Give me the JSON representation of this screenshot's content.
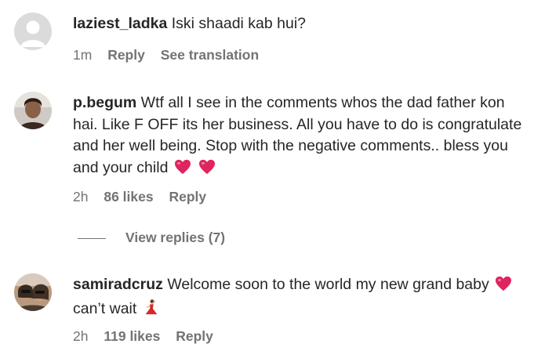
{
  "comments": [
    {
      "username": "laziest_ladka",
      "text": "Iski shaadi kab hui?",
      "time": "1m",
      "reply_label": "Reply",
      "translation_label": "See translation",
      "avatar_icon": "default-avatar-icon"
    },
    {
      "username": "p.begum",
      "text": "Wtf all I see in the comments whos the dad father kon hai. Like F OFF its her business. All you have to do is congratulate and her well being. Stop with the negative comments.. bless you and your child",
      "time": "2h",
      "likes": "86 likes",
      "reply_label": "Reply",
      "avatar_icon": "profile-photo-icon",
      "emoji": [
        "red-heart-icon",
        "red-heart-icon"
      ],
      "view_replies_label": "View replies (7)"
    },
    {
      "username": "samiradcruz",
      "text_part1": "Welcome soon to the world my new grand baby",
      "text_part2": "can’t wait",
      "time": "2h",
      "likes": "119 likes",
      "reply_label": "Reply",
      "avatar_icon": "profile-photo-icon",
      "emoji": [
        "red-heart-icon",
        "dancing-woman-icon"
      ]
    }
  ],
  "colors": {
    "text": "#262626",
    "secondary": "#737373",
    "heart": "#e0245e"
  }
}
